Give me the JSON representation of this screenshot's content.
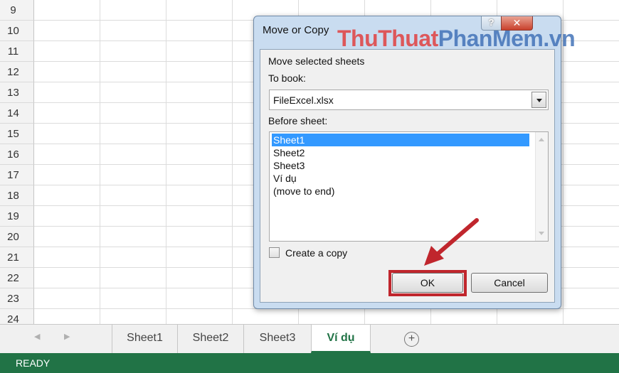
{
  "grid": {
    "row_numbers": [
      "9",
      "10",
      "11",
      "12",
      "13",
      "14",
      "15",
      "16",
      "17",
      "18",
      "19",
      "20",
      "21",
      "22",
      "23",
      "24"
    ]
  },
  "tabs": {
    "nav_prev": "◀",
    "nav_next": "▶",
    "items": [
      "Sheet1",
      "Sheet2",
      "Sheet3",
      "Ví dụ"
    ],
    "active": "Ví dụ",
    "add": "+"
  },
  "status": {
    "text": "READY"
  },
  "dialog": {
    "title": "Move or Copy",
    "help": "?",
    "close": "✕",
    "watermark": {
      "part1": "ThuThuat",
      "part2": "PhanMem",
      "part3": ".vn"
    },
    "subtitle": "Move selected sheets",
    "to_book_label": "To book:",
    "to_book_value": "FileExcel.xlsx",
    "before_sheet_label": "Before sheet:",
    "sheets": [
      "Sheet1",
      "Sheet2",
      "Sheet3",
      "Ví dụ",
      "(move to end)"
    ],
    "selected_sheet": "Sheet1",
    "create_copy_label": "Create a copy",
    "create_copy_checked": false,
    "ok": "OK",
    "cancel": "Cancel"
  },
  "colors": {
    "excel_green": "#217346",
    "highlight_red": "#c0262d",
    "selection_blue": "#3399ff"
  }
}
